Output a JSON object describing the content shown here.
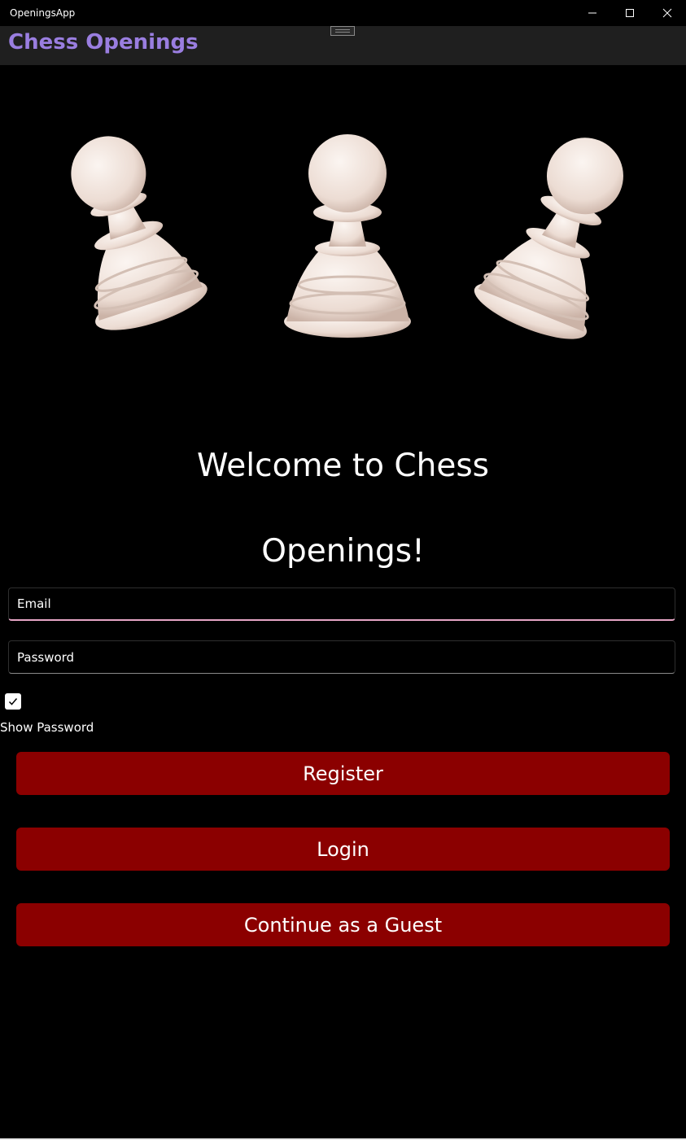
{
  "window": {
    "title": "OpeningsApp"
  },
  "navbar": {
    "title": "Chess Openings"
  },
  "hero": {
    "image_name": "chess-pawns-image",
    "pawn_color": "#efe3dc"
  },
  "welcome": {
    "line1": "Welcome to Chess",
    "line2": "Openings!"
  },
  "form": {
    "email_placeholder": "Email",
    "email_value": "",
    "password_placeholder": "Password",
    "password_value": "",
    "show_password_checked": true,
    "show_password_label": "Show Password"
  },
  "buttons": {
    "register": "Register",
    "login": "Login",
    "guest": "Continue as a Guest"
  },
  "colors": {
    "accent_title": "#9a7ee0",
    "button_bg": "#8b0000",
    "focus_underline": "#e6a6c6",
    "background": "#000000"
  }
}
